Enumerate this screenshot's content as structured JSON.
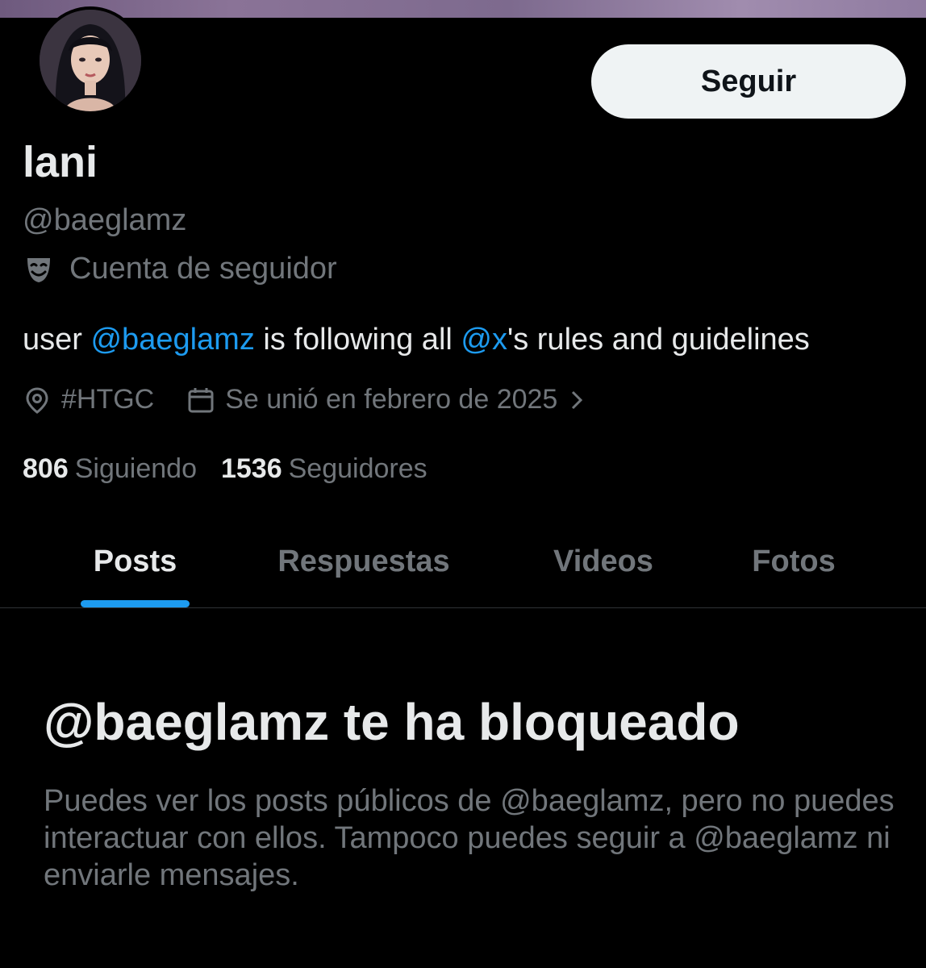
{
  "profile": {
    "display_name": "lani",
    "handle": "@baeglamz",
    "account_type": "Cuenta de seguidor",
    "account_type_icon": "mask-icon",
    "follow_button": "Seguir",
    "bio": {
      "part1": "user ",
      "mention1": "@baeglamz",
      "part2": " is following all ",
      "mention2": "@x",
      "part3": "'s rules and guidelines"
    },
    "location": "#HTGC",
    "location_icon": "location-pin-icon",
    "joined": "Se unió en febrero de 2025",
    "joined_icon": "calendar-icon",
    "following_count": "806",
    "following_label": "Siguiendo",
    "followers_count": "1536",
    "followers_label": "Seguidores"
  },
  "tabs": [
    {
      "label": "Posts",
      "active": true
    },
    {
      "label": "Respuestas",
      "active": false
    },
    {
      "label": "Videos",
      "active": false
    },
    {
      "label": "Fotos",
      "active": false
    }
  ],
  "blocked": {
    "title": "@baeglamz te ha bloqueado",
    "message": "Puedes ver los posts públicos de @baeglamz, pero no puedes interactuar con ellos. Tampoco puedes seguir a @baeglamz ni enviarle mensajes."
  },
  "colors": {
    "background": "#000000",
    "accent": "#1d9bf0",
    "primary_text": "#e7e9ea",
    "secondary_text": "#71767b"
  }
}
